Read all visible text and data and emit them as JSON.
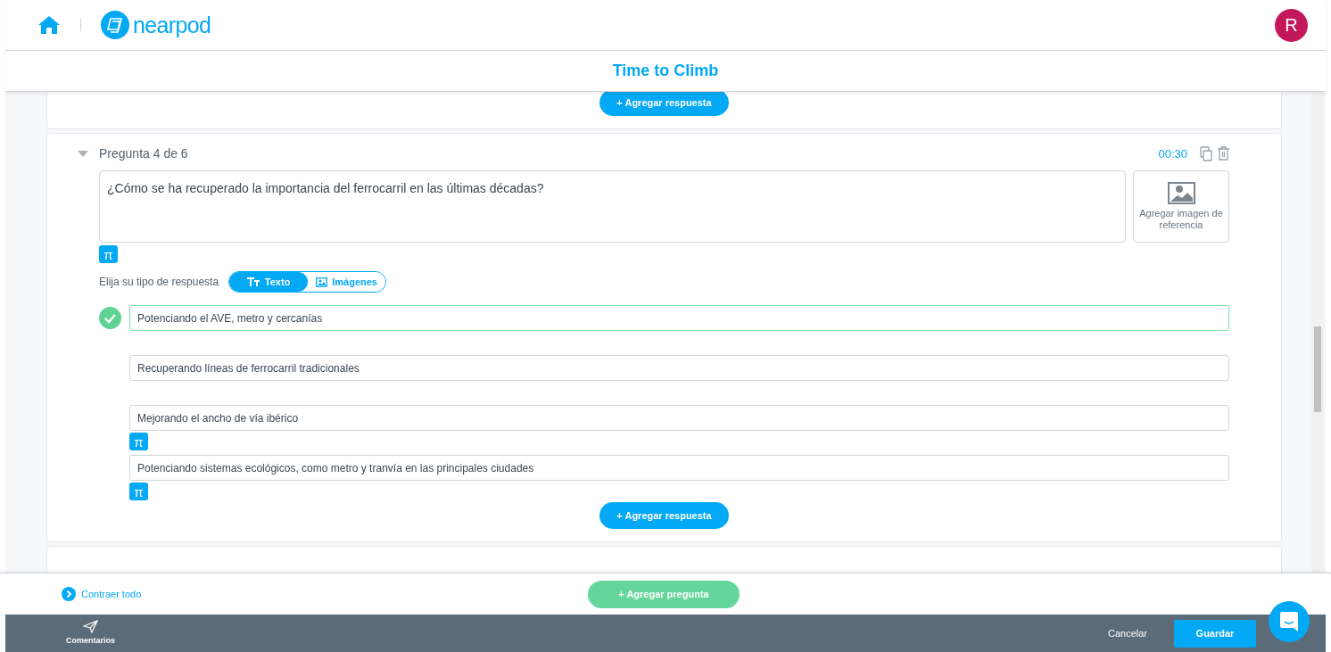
{
  "header": {
    "brand": "nearpod",
    "avatar": "R"
  },
  "title": "Time to Climb",
  "previous_card": {
    "add_answer": "+ Agregar respuesta"
  },
  "question": {
    "heading": "Pregunta 4 de 6",
    "expanded": true,
    "timer": "00:30",
    "text": "¿Cómo se ha recuperado la importancia del ferrocarril en las últimas décadas?",
    "math_button": "π",
    "reference_image": "Agregar imagen de referencia",
    "answer_type_label": "Elija su tipo de respuesta",
    "answer_types": [
      {
        "label": "Texto",
        "selected": true
      },
      {
        "label": "Imágenes",
        "selected": false
      }
    ],
    "answers": [
      {
        "text": "Potenciando el AVE, metro y cercanías",
        "correct": true
      },
      {
        "text": "Recuperando líneas de ferrocarril tradicionales",
        "correct": false
      },
      {
        "text": "Mejorando el ancho de vía ibérico",
        "correct": false,
        "math_button": "π"
      },
      {
        "text": "Potenciando sistemas ecológicos, como metro y tranvía en las principales ciudades",
        "correct": false,
        "math_button": "π"
      }
    ],
    "add_answer": "+ Agregar respuesta"
  },
  "toolbar": {
    "collapse_all": "Contraer todo",
    "add_question": "+ Agregar pregunta"
  },
  "footer": {
    "comments": "Comentarios",
    "cancel": "Cancelar",
    "save": "Guardar"
  }
}
